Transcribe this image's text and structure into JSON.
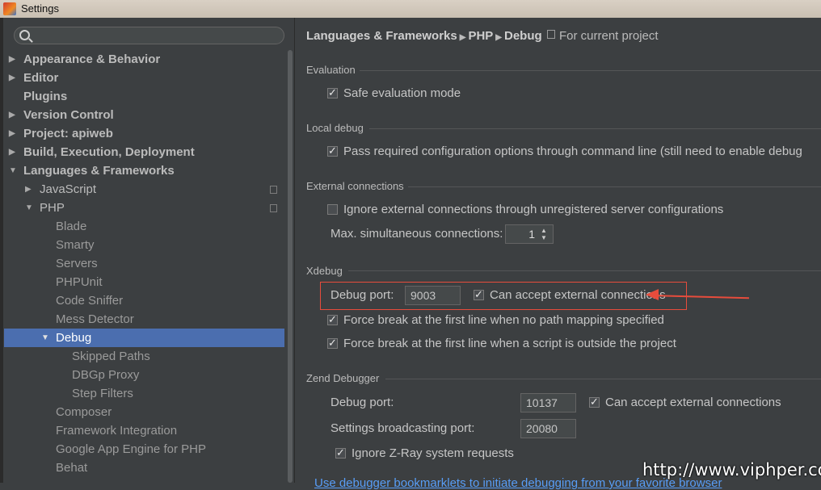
{
  "window": {
    "title": "Settings"
  },
  "sidebar": {
    "search_placeholder": "",
    "items": [
      {
        "label": "Appearance & Behavior",
        "level": 0,
        "arrow": "collapsed",
        "bold": true
      },
      {
        "label": "Editor",
        "level": 0,
        "arrow": "collapsed",
        "bold": true
      },
      {
        "label": "Plugins",
        "level": 0,
        "arrow": "none",
        "bold": true
      },
      {
        "label": "Version Control",
        "level": 0,
        "arrow": "collapsed",
        "bold": true
      },
      {
        "label": "Project: apiweb",
        "level": 0,
        "arrow": "collapsed",
        "bold": true
      },
      {
        "label": "Build, Execution, Deployment",
        "level": 0,
        "arrow": "collapsed",
        "bold": true
      },
      {
        "label": "Languages & Frameworks",
        "level": 0,
        "arrow": "expanded",
        "bold": true
      },
      {
        "label": "JavaScript",
        "level": 1,
        "arrow": "collapsed",
        "copy": true
      },
      {
        "label": "PHP",
        "level": 1,
        "arrow": "expanded",
        "copy": true
      },
      {
        "label": "Blade",
        "level": 2,
        "arrow": "none"
      },
      {
        "label": "Smarty",
        "level": 2,
        "arrow": "none"
      },
      {
        "label": "Servers",
        "level": 2,
        "arrow": "none"
      },
      {
        "label": "PHPUnit",
        "level": 2,
        "arrow": "none"
      },
      {
        "label": "Code Sniffer",
        "level": 2,
        "arrow": "none"
      },
      {
        "label": "Mess Detector",
        "level": 2,
        "arrow": "none"
      },
      {
        "label": "Debug",
        "level": 2,
        "arrow": "expanded",
        "selected": true
      },
      {
        "label": "Skipped Paths",
        "level": 3,
        "arrow": "none"
      },
      {
        "label": "DBGp Proxy",
        "level": 3,
        "arrow": "none"
      },
      {
        "label": "Step Filters",
        "level": 3,
        "arrow": "none"
      },
      {
        "label": "Composer",
        "level": 2,
        "arrow": "none"
      },
      {
        "label": "Framework Integration",
        "level": 2,
        "arrow": "none"
      },
      {
        "label": "Google App Engine for PHP",
        "level": 2,
        "arrow": "none"
      },
      {
        "label": "Behat",
        "level": 2,
        "arrow": "none"
      }
    ]
  },
  "header": {
    "crumbs": [
      "Languages & Frameworks",
      "PHP",
      "Debug"
    ],
    "scope": "For current project"
  },
  "evaluation": {
    "title": "Evaluation",
    "safe_mode": {
      "label": "Safe evaluation mode",
      "checked": true
    }
  },
  "local_debug": {
    "title": "Local debug",
    "pass_config": {
      "label": "Pass required configuration options through command line (still need to enable debug",
      "checked": true
    }
  },
  "external": {
    "title": "External connections",
    "ignore": {
      "label": "Ignore external connections through unregistered server configurations",
      "checked": false
    },
    "max_label": "Max. simultaneous connections:",
    "max_value": "1"
  },
  "xdebug": {
    "title": "Xdebug",
    "port_label": "Debug port:",
    "port_value": "9003",
    "accept": {
      "label": "Can accept external connections",
      "checked": true
    },
    "force_break_no_mapping": {
      "label": "Force break at the first line when no path mapping specified",
      "checked": true
    },
    "force_break_outside": {
      "label": "Force break at the first line when a script is outside the project",
      "checked": true
    }
  },
  "zend": {
    "title": "Zend Debugger",
    "port_label": "Debug port:",
    "port_value": "10137",
    "accept": {
      "label": "Can accept external connections",
      "checked": true
    },
    "broadcast_label": "Settings broadcasting port:",
    "broadcast_value": "20080",
    "ignore_zray": {
      "label": "Ignore Z-Ray system requests",
      "checked": true
    }
  },
  "footer": {
    "link": "Use debugger bookmarklets to initiate debugging from your favorite browser"
  },
  "watermark": "http://www.viphper.com",
  "colors": {
    "selection": "#4b6eaf",
    "annotation": "#e74c3c",
    "link": "#589df6"
  }
}
